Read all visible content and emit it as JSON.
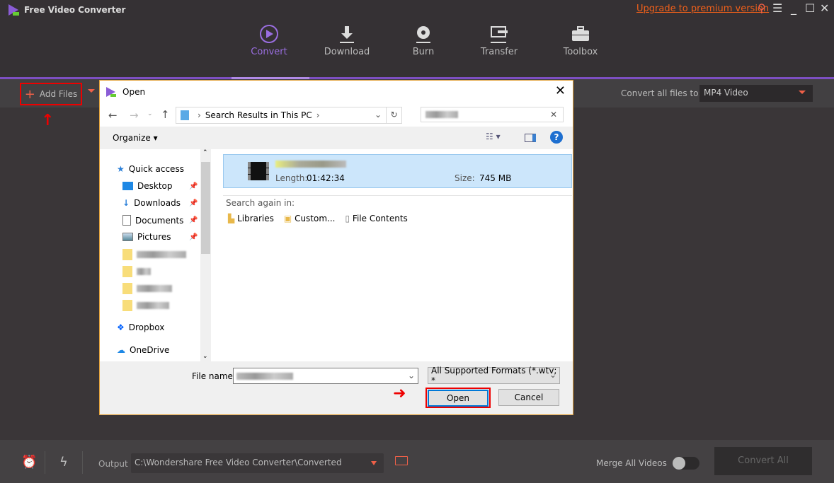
{
  "app": {
    "title": "Free Video Converter",
    "upgrade_link": "Upgrade to premium version"
  },
  "nav": [
    {
      "label": "Convert",
      "icon": "convert-icon",
      "active": true
    },
    {
      "label": "Download",
      "icon": "download-icon"
    },
    {
      "label": "Burn",
      "icon": "disc-icon"
    },
    {
      "label": "Transfer",
      "icon": "transfer-icon"
    },
    {
      "label": "Toolbox",
      "icon": "toolbox-icon"
    }
  ],
  "toolbar": {
    "add_files": "Add Files",
    "convert_all_label": "Convert all files to:",
    "convert_all_value": "MP4 Video"
  },
  "dialog": {
    "title": "Open",
    "address": "Search Results in This PC",
    "organize": "Organize",
    "sidebar": [
      "Quick access",
      "Desktop",
      "Downloads",
      "Documents",
      "Pictures",
      "Dropbox",
      "OneDrive"
    ],
    "result": {
      "length_label": "Length:",
      "length": "01:42:34",
      "size_label": "Size:",
      "size": "745 MB"
    },
    "search_again": "Search again in:",
    "search_locations": [
      "Libraries",
      "Custom...",
      "File Contents"
    ],
    "file_name_label": "File name:",
    "file_type": "All Supported Formats (*.wtv; *",
    "open": "Open",
    "cancel": "Cancel"
  },
  "bottom": {
    "output_label": "Output",
    "output_path": "C:\\Wondershare Free Video Converter\\Converted",
    "merge_label": "Merge All Videos",
    "merge_on": false,
    "convert_all": "Convert All"
  },
  "colors": {
    "accent": "#7d4fc2",
    "highlight": "#f06048",
    "annotation": "#e00000"
  }
}
